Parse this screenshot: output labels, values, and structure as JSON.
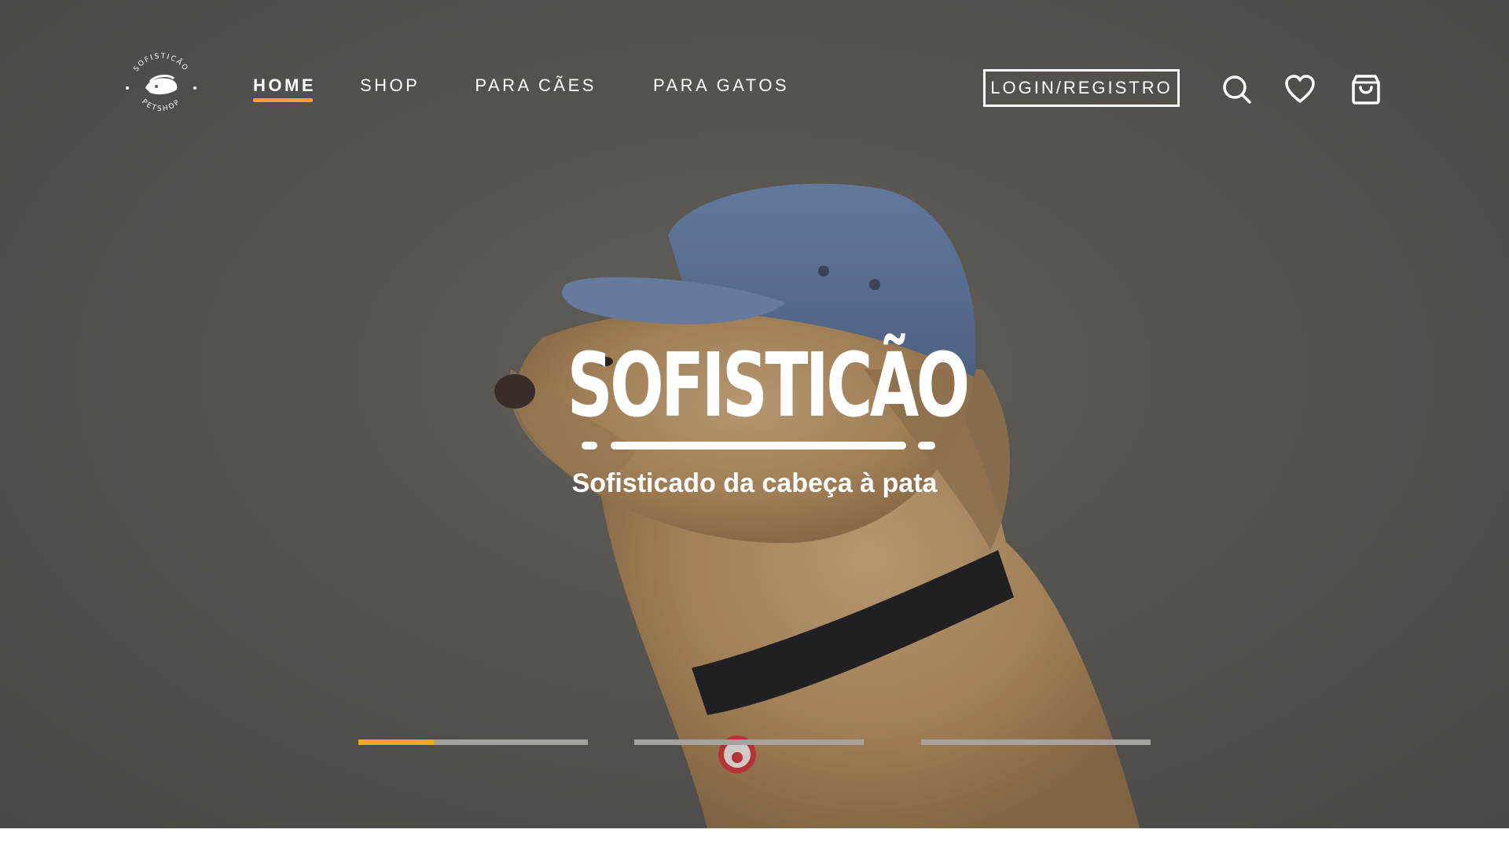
{
  "colors": {
    "accent": "#f5a623",
    "text": "#ffffff",
    "indicator_track": "#a6a39f"
  },
  "logo": {
    "ring_text_top": "SOFISTICÃO",
    "ring_text_bottom": "PETSHOP"
  },
  "nav": {
    "items": [
      {
        "label": "HOME",
        "active": true
      },
      {
        "label": "SHOP",
        "active": false
      },
      {
        "label": "PARA CÃES",
        "active": false
      },
      {
        "label": "PARA GATOS",
        "active": false
      }
    ]
  },
  "header": {
    "login_label": "LOGIN/REGISTRO",
    "icons": [
      "search-icon",
      "heart-icon",
      "shopping-bag-icon"
    ]
  },
  "hero": {
    "brand_title": "SOFISTICÃO",
    "tagline": "Sofisticado da cabeça à pata",
    "slides": [
      {
        "progress": 0.33
      },
      {
        "progress": 0
      },
      {
        "progress": 0
      }
    ]
  }
}
